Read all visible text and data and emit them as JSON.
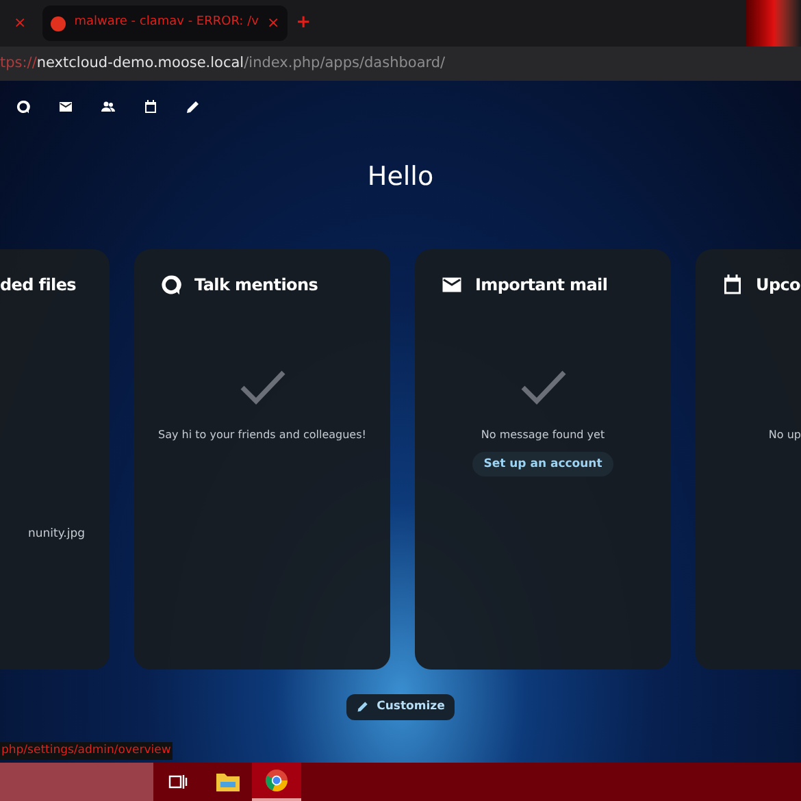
{
  "browser": {
    "tabs": [
      {
        "close": "×",
        "selected": false
      },
      {
        "title": "malware - clamav - ERROR: /v",
        "close": "×",
        "selected": true
      }
    ],
    "new_tab": "+",
    "address": {
      "scheme": "tps://",
      "host": "nextcloud-demo.moose.local",
      "path": "/index.php/apps/dashboard/"
    }
  },
  "app_nav": [
    {
      "kind": "talk",
      "selected": false
    },
    {
      "kind": "mail",
      "selected": false
    },
    {
      "kind": "contacts",
      "selected": false
    },
    {
      "kind": "calendar",
      "selected": false
    },
    {
      "kind": "notes",
      "selected": false
    }
  ],
  "greeting": "Hello",
  "widgets": [
    {
      "kind": "files",
      "title": "ded files",
      "items": [
        "nunity.jpg"
      ]
    },
    {
      "kind": "talk",
      "title": "Talk mentions",
      "empty_message": "Say hi to your friends and colleagues!"
    },
    {
      "kind": "mail",
      "title": "Important mail",
      "empty_message": "No message found yet",
      "action": "Set up an account"
    },
    {
      "kind": "calendar",
      "title": "Upco",
      "empty_message": "No up"
    }
  ],
  "customize_button": "Customize",
  "status_url": "php/settings/admin/overview",
  "taskbar": [
    {
      "kind": "taskview",
      "selected": false
    },
    {
      "kind": "explorer",
      "selected": false
    },
    {
      "kind": "chrome",
      "selected": true
    }
  ]
}
